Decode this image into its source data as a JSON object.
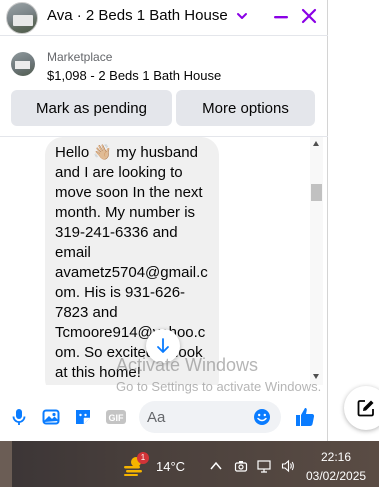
{
  "header": {
    "title": "Ava · 2 Beds 1 Bath House"
  },
  "listing": {
    "source": "Marketplace",
    "detail": "$1,098 - 2 Beds 1 Bath House"
  },
  "actions": {
    "mark_pending": "Mark as pending",
    "more_options": "More options"
  },
  "message": {
    "text": "Hello 👋🏼 my husband\nand I are looking to\nmove soon In the next\nmonth. My number is\n319-241-6336 and\nemail\navametz5704@gmail.c\nom. His is 931-626-\n7823 and\nTcmoore914@yahoo.c\nom. So excited to look\nat this home!"
  },
  "watermark": {
    "title": "Activate Windows",
    "subtitle": "Go to Settings to activate Windows."
  },
  "composer": {
    "placeholder": "Aa",
    "icons": [
      "microphone-icon",
      "image-icon",
      "sticker-icon",
      "gif-icon",
      "emoji-icon",
      "thumbs-up-icon"
    ]
  },
  "taskbar": {
    "weather_badge": "1",
    "temperature": "14°C",
    "time": "22:16",
    "date": "03/02/2025"
  },
  "colors": {
    "accent": "#8a00e5",
    "blue": "#0a7cff",
    "bubble": "#f0f0f0"
  }
}
